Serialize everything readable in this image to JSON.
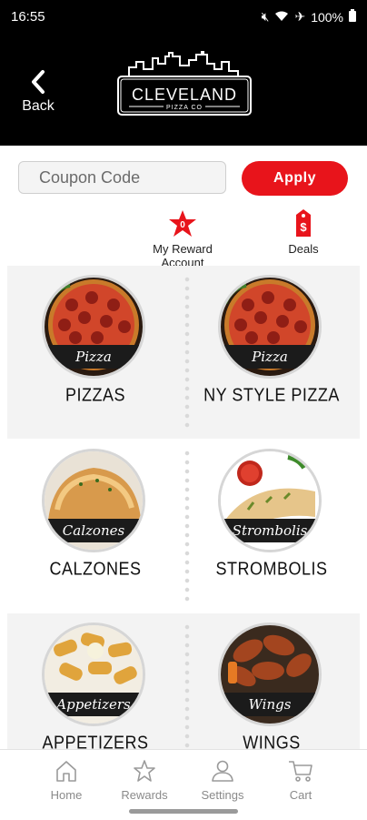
{
  "status_bar": {
    "time": "16:55",
    "battery": "100%"
  },
  "header": {
    "back_label": "Back",
    "logo_title": "CLEVELAND",
    "logo_sub": "PIZZA CO"
  },
  "coupon": {
    "placeholder": "Coupon Code",
    "apply_label": "Apply"
  },
  "actions": {
    "reward": {
      "count": "0",
      "label": "My Reward Account"
    },
    "deals": {
      "symbol": "$",
      "label": "Deals"
    }
  },
  "menu": {
    "items": [
      {
        "label": "PIZZAS",
        "banner": "Pizza"
      },
      {
        "label": "NY STYLE PIZZA",
        "banner": "Pizza"
      },
      {
        "label": "CALZONES",
        "banner": "Calzones"
      },
      {
        "label": "STROMBOLIS",
        "banner": "Strombolis"
      },
      {
        "label": "APPETIZERS",
        "banner": "Appetizers"
      },
      {
        "label": "WINGS",
        "banner": "Wings"
      }
    ]
  },
  "tabbar": {
    "home": "Home",
    "rewards": "Rewards",
    "settings": "Settings",
    "cart": "Cart"
  },
  "colors": {
    "accent": "#e8141b",
    "header_bg": "#000000",
    "tile_bg": "#f3f3f3"
  }
}
